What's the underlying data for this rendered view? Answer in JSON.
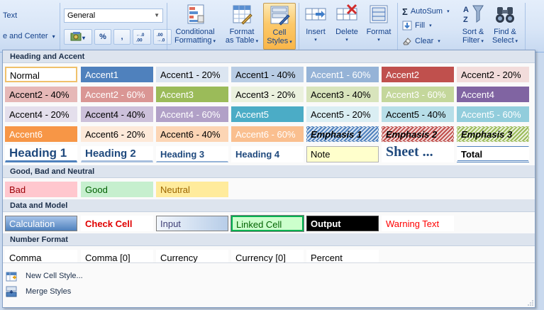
{
  "ribbon": {
    "alignment": {
      "wrap_text_label": "Text",
      "merge_center_label": "e and Center"
    },
    "number": {
      "format_value": "General",
      "buttons": [
        "$",
        "%",
        ",",
        ".0→.00",
        ".00→.0"
      ]
    },
    "styles": {
      "conditional_formatting_label": [
        "Conditional",
        "Formatting"
      ],
      "format_as_table_label": [
        "Format",
        "as Table"
      ],
      "cell_styles_label": [
        "Cell",
        "Styles"
      ]
    },
    "cells": {
      "insert_label": "Insert",
      "delete_label": "Delete",
      "format_label": "Format"
    },
    "editing": {
      "autosum_label": "AutoSum",
      "fill_label": "Fill",
      "clear_label": "Clear",
      "sort_filter_label": [
        "Sort &",
        "Filter"
      ],
      "find_select_label": [
        "Find &",
        "Select"
      ]
    }
  },
  "gallery": {
    "sections": [
      {
        "title": "Heading and Accent"
      },
      {
        "title": "Good, Bad and Neutral"
      },
      {
        "title": "Data and Model"
      },
      {
        "title": "Number Format"
      }
    ],
    "heading_accent_rows": [
      [
        "Normal",
        "Accent1",
        "Accent1 - 20%",
        "Accent1 - 40%",
        "Accent1 - 60%",
        "Accent2",
        "Accent2 - 20%"
      ],
      [
        "Accent2 - 40%",
        "Accent2 - 60%",
        "Accent3",
        "Accent3 - 20%",
        "Accent3 - 40%",
        "Accent3 - 60%",
        "Accent4"
      ],
      [
        "Accent4 - 20%",
        "Accent4 - 40%",
        "Accent4 - 60%",
        "Accent5",
        "Accent5 - 20%",
        "Accent5 - 40%",
        "Accent5 - 60%"
      ],
      [
        "Accent6",
        "Accent6 - 20%",
        "Accent6 - 40%",
        "Accent6 - 60%",
        "Emphasis 1",
        "Emphasis 2",
        "Emphasis 3"
      ],
      [
        "Heading 1",
        "Heading 2",
        "Heading 3",
        "Heading 4",
        "Note",
        "Sheet ...",
        "Total"
      ]
    ],
    "good_bad_neutral": [
      "Bad",
      "Good",
      "Neutral"
    ],
    "data_model": [
      "Calculation",
      "Check Cell",
      "Input",
      "Linked Cell",
      "Output",
      "Warning Text"
    ],
    "number_format": [
      "Comma",
      "Comma [0]",
      "Currency",
      "Currency [0]",
      "Percent"
    ],
    "menu": {
      "new_cell_style_label": "New Cell Style...",
      "merge_styles_label": "Merge Styles"
    }
  },
  "colors": {
    "accent1": "#4f81bd",
    "accent2": "#c0504d",
    "accent3": "#9bbb59",
    "accent4": "#8064a2",
    "accent5": "#4bacc6",
    "accent6": "#f79646",
    "ribbon_active": "#fcc96a"
  }
}
